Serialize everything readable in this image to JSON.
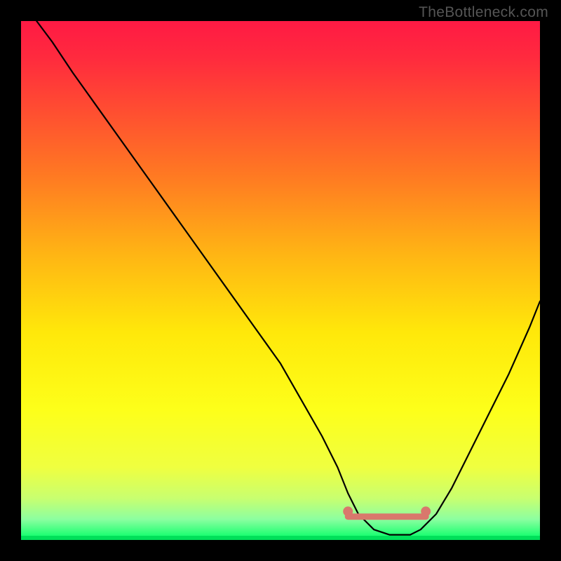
{
  "watermark": "TheBottleneck.com",
  "chart_data": {
    "type": "line",
    "title": "",
    "xlabel": "",
    "ylabel": "",
    "xlim": [
      0,
      100
    ],
    "ylim": [
      0,
      100
    ],
    "background_gradient": {
      "stops": [
        {
          "offset": 0.0,
          "color": "#ff1a44"
        },
        {
          "offset": 0.07,
          "color": "#ff2a3e"
        },
        {
          "offset": 0.18,
          "color": "#ff5030"
        },
        {
          "offset": 0.3,
          "color": "#ff7a22"
        },
        {
          "offset": 0.45,
          "color": "#ffb514"
        },
        {
          "offset": 0.6,
          "color": "#ffe80a"
        },
        {
          "offset": 0.75,
          "color": "#fdff1a"
        },
        {
          "offset": 0.86,
          "color": "#efff40"
        },
        {
          "offset": 0.92,
          "color": "#c8ff70"
        },
        {
          "offset": 0.96,
          "color": "#8cffa0"
        },
        {
          "offset": 1.0,
          "color": "#00ff66"
        }
      ]
    },
    "series": [
      {
        "name": "bottleneck-curve",
        "color": "#000000",
        "x": [
          3,
          6,
          10,
          15,
          20,
          25,
          30,
          35,
          40,
          45,
          50,
          54,
          58,
          61,
          63,
          65,
          68,
          71,
          73,
          75,
          77,
          80,
          83,
          86,
          90,
          94,
          98,
          100
        ],
        "y": [
          100,
          96,
          90,
          83,
          76,
          69,
          62,
          55,
          48,
          41,
          34,
          27,
          20,
          14,
          9,
          5,
          2,
          1,
          1,
          1,
          2,
          5,
          10,
          16,
          24,
          32,
          41,
          46
        ]
      }
    ],
    "optimal_band": {
      "color": "#d9786c",
      "x_start": 63,
      "x_end": 78,
      "y": 4.5,
      "thickness": 2.6
    },
    "optimal_endpoints": {
      "color": "#d9786c",
      "points": [
        {
          "x": 63,
          "y": 5.5
        },
        {
          "x": 78,
          "y": 5.5
        }
      ],
      "radius": 1.6
    }
  }
}
